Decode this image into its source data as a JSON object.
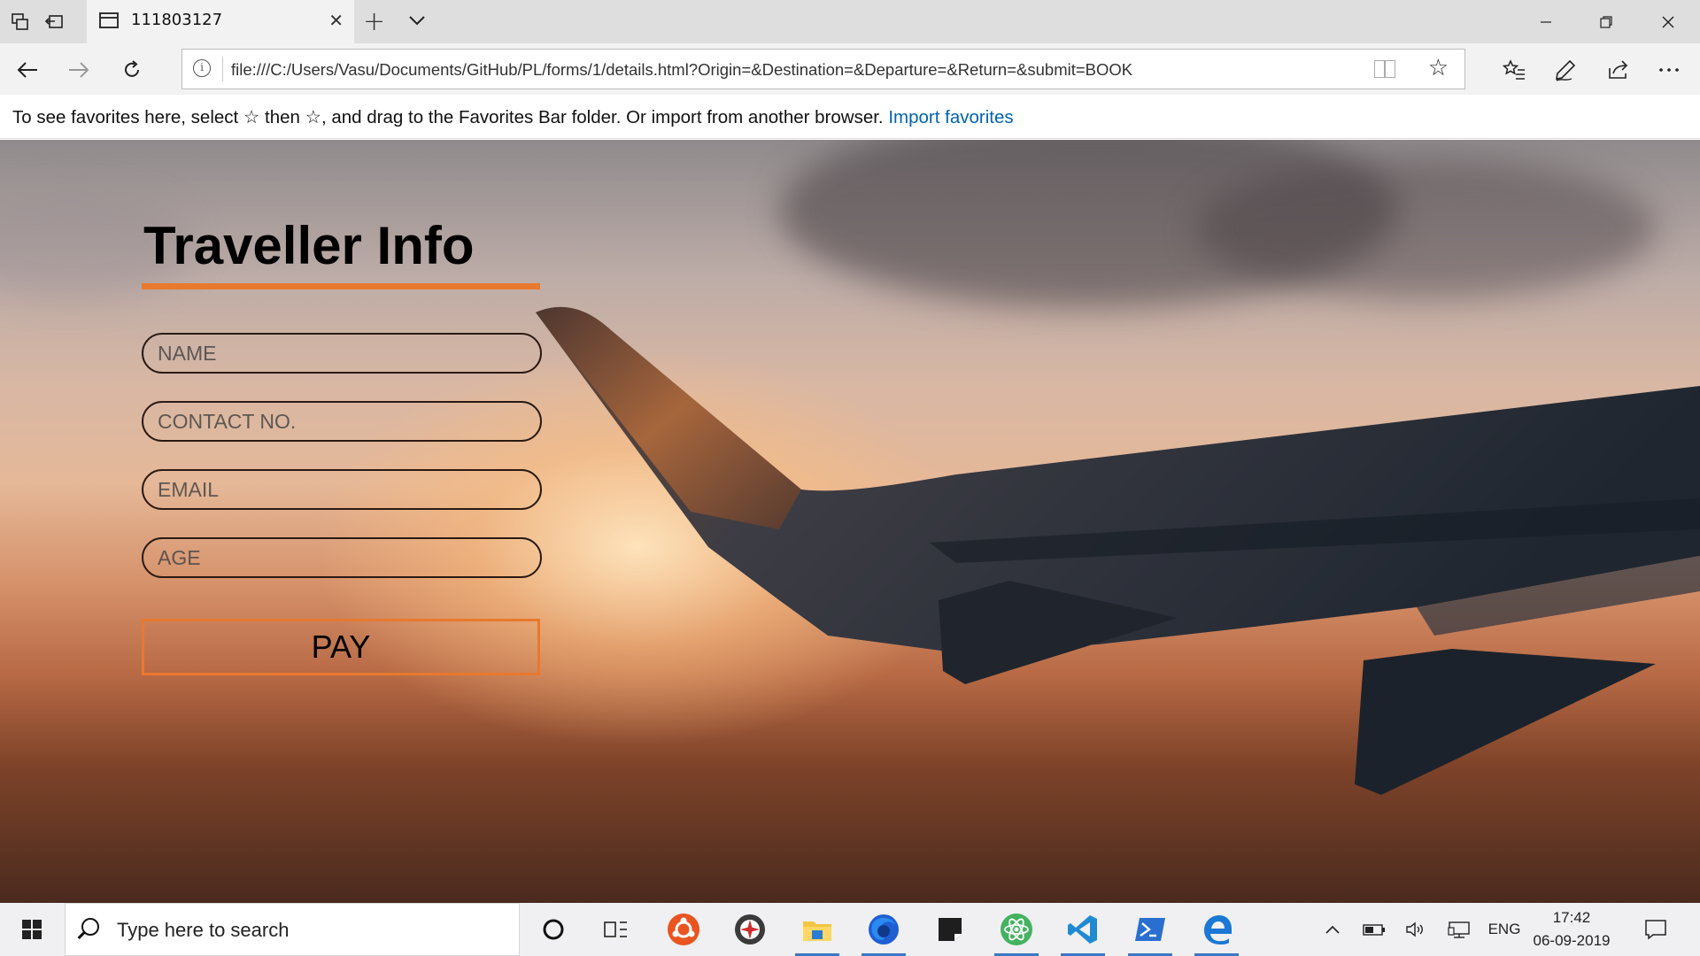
{
  "browser": {
    "tab_title": "111803127",
    "url": "file:///C:/Users/Vasu/Documents/GitHub/PL/forms/1/details.html?Origin=&Destination=&Departure=&Return=&submit=BOOK",
    "favorites_message": "To see favorites here, select  ☆  then ☆, and drag to the Favorites Bar folder. Or import from another browser.",
    "import_link": "Import favorites"
  },
  "form": {
    "title": "Traveller Info",
    "fields": [
      {
        "placeholder": "NAME"
      },
      {
        "placeholder": "CONTACT NO."
      },
      {
        "placeholder": "EMAIL"
      },
      {
        "placeholder": "AGE"
      }
    ],
    "submit_label": "PAY"
  },
  "taskbar": {
    "search_placeholder": "Type here to search",
    "language": "ENG",
    "time": "17:42",
    "date": "06-09-2019"
  },
  "colors": {
    "accent": "#e8792e",
    "link": "#0063b1",
    "taskbar_active": "#3b78c4"
  }
}
